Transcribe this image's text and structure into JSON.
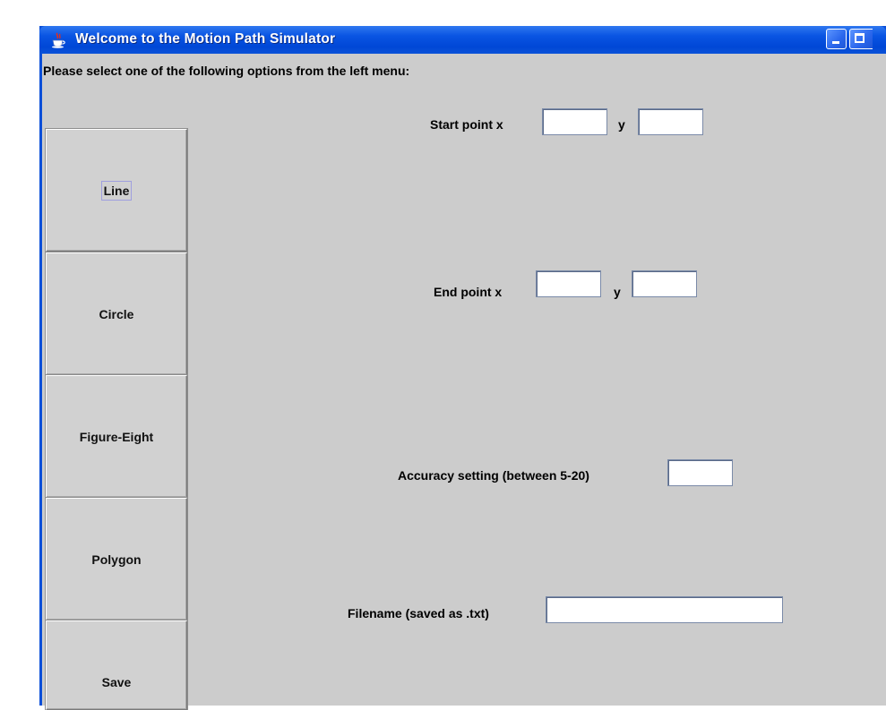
{
  "window": {
    "title": "Welcome to the Motion Path Simulator",
    "icon": "java-cup-icon",
    "controls": [
      "minimize",
      "maximize"
    ]
  },
  "instructions": "Please select one of the following options from the left menu:",
  "menu": {
    "items": [
      {
        "label": "Line"
      },
      {
        "label": "Circle"
      },
      {
        "label": "Figure-Eight"
      },
      {
        "label": "Polygon"
      },
      {
        "label": "Save"
      }
    ],
    "focused": "Line"
  },
  "form": {
    "start_point_label": "Start point  x",
    "start_x": "",
    "start_y_label": "y",
    "start_y": "",
    "end_point_label": "End point  x",
    "end_x": "",
    "end_y_label": "y",
    "end_y": "",
    "accuracy_label": "Accuracy setting (between 5-20)",
    "accuracy": "",
    "filename_label": "Filename (saved as .txt)",
    "filename": ""
  },
  "colors": {
    "titlebar": "#0a55e3",
    "panel": "#cccccc"
  }
}
